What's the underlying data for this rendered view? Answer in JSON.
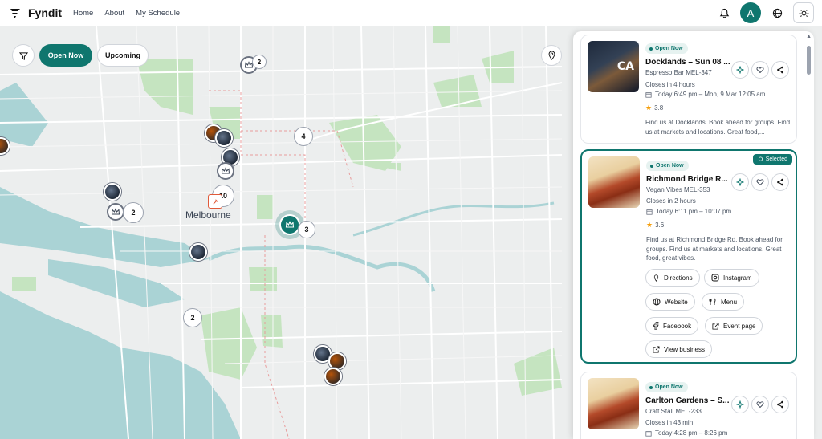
{
  "header": {
    "brand": "Fyndit",
    "nav": [
      "Home",
      "About",
      "My Schedule"
    ],
    "avatar_initial": "A",
    "icons": [
      "bell-icon",
      "globe-icon",
      "sun-icon"
    ]
  },
  "map": {
    "filter_icon": "filter-icon",
    "open_now_label": "Open Now",
    "upcoming_label": "Upcoming",
    "city_label": "Melbourne",
    "location_icon": "map-pin-icon",
    "cluster_counts": [
      "2",
      "4",
      "10",
      "2",
      "3",
      "2"
    ],
    "colors": {
      "accent": "#0f766e",
      "water": "#aad3d5",
      "park": "#c5e4c0",
      "land": "#eceeee"
    }
  },
  "cards": [
    {
      "status": "Open Now",
      "title": "Docklands – Sun 08 ...",
      "subtitle": "Espresso Bar MEL-347",
      "closes": "Closes in 4 hours",
      "time": "Today 6:49 pm – Mon, 9 Mar 12:05 am",
      "rating": "3.8",
      "description": "Find us at Docklands. Book ahead for groups. Find us at markets and locations. Great food,..."
    },
    {
      "status": "Open Now",
      "selected_label": "Selected",
      "title": "Richmond Bridge R...",
      "subtitle": "Vegan Vibes MEL-353",
      "closes": "Closes in 2 hours",
      "time": "Today 6:11 pm – 10:07 pm",
      "rating": "3.6",
      "description": "Find us at Richmond Bridge Rd. Book ahead for groups. Find us at markets and locations. Great food, great vibes.",
      "links": {
        "directions": "Directions",
        "instagram": "Instagram",
        "website": "Website",
        "menu": "Menu",
        "facebook": "Facebook",
        "event_page": "Event page",
        "view_business": "View business"
      }
    },
    {
      "status": "Open Now",
      "title": "Carlton Gardens – S...",
      "subtitle": "Craft Stall MEL-233",
      "closes": "Closes in 43 min",
      "time": "Today 4:28 pm – 8:26 pm"
    }
  ]
}
